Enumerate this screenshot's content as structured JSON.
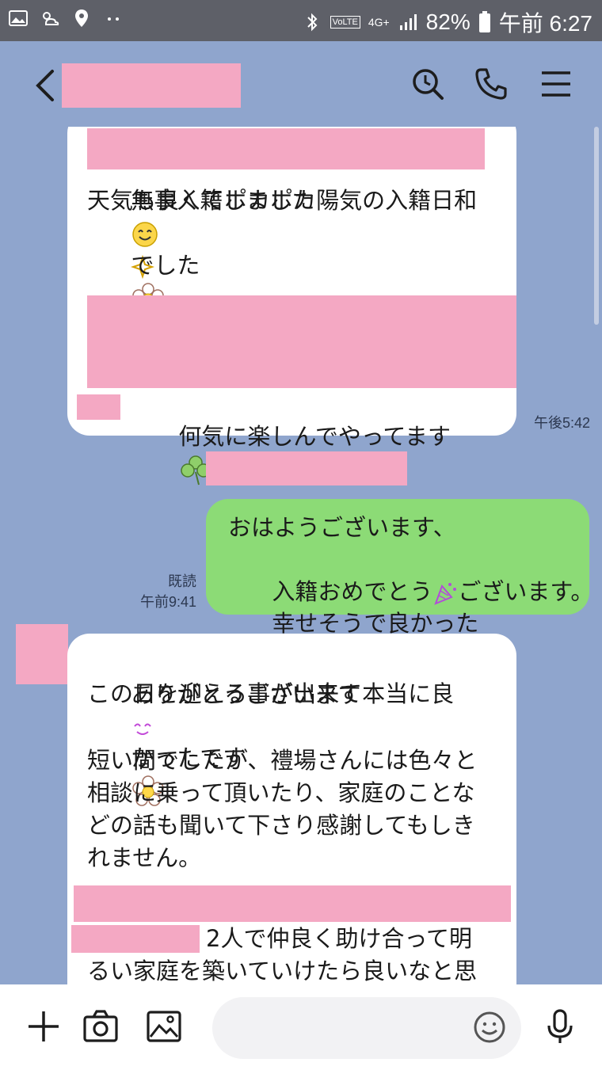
{
  "status_bar": {
    "volte": "VoLTE",
    "network": "4G+",
    "battery": "82%",
    "time": "午前 6:27"
  },
  "header": {
    "icons": [
      "back-chevron-icon",
      "search-history-icon",
      "phone-icon",
      "menu-icon"
    ]
  },
  "messages": [
    {
      "side": "in",
      "lines": [
        "無事入籍しました",
        "天気も良くてポカポカ陽気の入籍日和",
        "でした",
        "何気に楽しんでやってます"
      ],
      "time": "午後5:42"
    },
    {
      "side": "out",
      "lines": [
        "おはようございます、",
        "入籍おめでとう",
        "ございます。",
        "幸せそうで良かった"
      ],
      "read": "既読",
      "time": "午前9:41"
    },
    {
      "side": "in",
      "lines": [
        "ありがとうございます",
        "この日を迎える事が出来て本当に良",
        "かったです",
        "短い間でしたが、禮場さんには色々と",
        "相談に乗って頂いたり、家庭のことな",
        "どの話も聞いて下さり感謝してもしき",
        "れません。",
        "2人で仲良く助け合って明",
        "るい家庭を築いていけたら良いなと思"
      ]
    }
  ],
  "input": {
    "placeholder": ""
  },
  "colors": {
    "background": "#8fa5cd",
    "outgoing": "#8cdb76",
    "incoming": "#ffffff",
    "redaction": "#f4a8c3"
  }
}
